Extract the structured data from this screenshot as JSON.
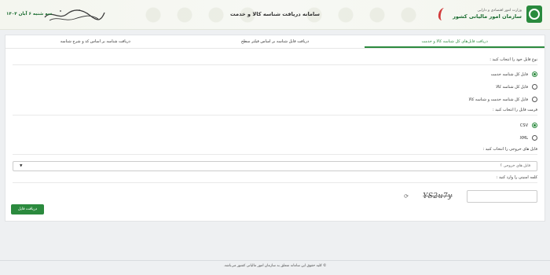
{
  "header": {
    "org_small": "وزارت امور اقتصادی و دارایی",
    "org_big": "سازمان امور مالیاتی کشور",
    "app_title": "سامانه دریافت شناسه کالا و خدمت",
    "date": "سه شنبه ۶ آبان ۱۴۰۴",
    "colors": {
      "brand": "#2b8a3e",
      "accent": "#d23b3b"
    }
  },
  "tabs": [
    {
      "label": "دریافت فایل‌های کل شناسه کالا و خدمت",
      "active": true
    },
    {
      "label": "دریافت فایل شناسه بر اساس فیلتر سطح",
      "active": false
    },
    {
      "label": "دریافت شناسه بر اساس کد و شرح شناسه",
      "active": false
    }
  ],
  "form": {
    "file_type_label": "نوع فایل خود را انتخاب کنید :",
    "file_type_options": [
      {
        "label": "فایل کل شناسه خدمت",
        "selected": true
      },
      {
        "label": "فایل کل شناسه کالا",
        "selected": false
      },
      {
        "label": "فایل کل شناسه خدمت و شناسه کالا",
        "selected": false
      }
    ],
    "format_label": "فرمت فایل را انتخاب کنید :",
    "format_options": [
      {
        "label": "CSV",
        "selected": true
      },
      {
        "label": "XML",
        "selected": false
      }
    ],
    "output_label": "فایل های خروجی را انتخاب کنید :",
    "output_placeholder": "فایل های خروجی ؟",
    "captcha_label": "کلمه امنیتی را وارد کنید :",
    "captcha_text": "YS2u7y",
    "submit_label": "دریافت فایل"
  },
  "footer": {
    "text": "© کلیه حقوق این سامانه متعلق به سازمان امور مالیاتی کشور می‌باشد."
  }
}
